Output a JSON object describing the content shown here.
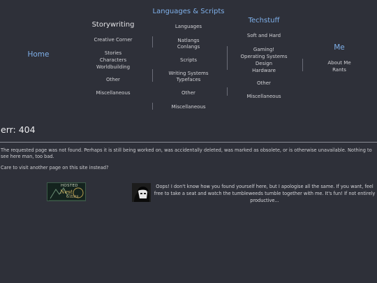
{
  "nav": {
    "home": {
      "label": "Home"
    },
    "storywriting": {
      "label": "Storywriting",
      "items": [
        "Creative Corner",
        "Stories",
        "Characters",
        "Worldbuilding",
        "Other",
        "Miscellaneous"
      ]
    },
    "languages": {
      "label": "Languages & Scripts",
      "items": [
        "Languages",
        "Natlangs",
        "Conlangs",
        "Scripts",
        "Writing Systems",
        "Typefaces",
        "Other",
        "Miscellaneous"
      ]
    },
    "techstuff": {
      "label": "Techstuff",
      "items": [
        "Soft and Hard",
        "Gaming!",
        "Operating Systems",
        "Design",
        "Hardware",
        "Other",
        "Miscellaneous"
      ]
    },
    "me": {
      "label": "Me",
      "items": [
        "About Me",
        "Rants"
      ]
    }
  },
  "error": {
    "title": "err: 404",
    "message": "The requested page was not found. Perhaps it is still being worked on, was accidentally deleted, was marked as obsolete, or is otherwise unavailable. Nothing to see here man, too bad.",
    "prompt": "Care to visit another page on this site instead?"
  },
  "badge": {
    "line1": "HOSTED",
    "line2": "Nest",
    "line3": "Cities"
  },
  "note": {
    "text": "Oops! I don't know how you found yourself here, but I apologise all the same. If you want, feel free to take a seat and watch the tumbleweeds tumble together with me. It's fun! If not entirely productive..."
  },
  "colors": {
    "background": "#2e3039",
    "accent": "#7fb0ea",
    "text": "#d8d8dc"
  }
}
